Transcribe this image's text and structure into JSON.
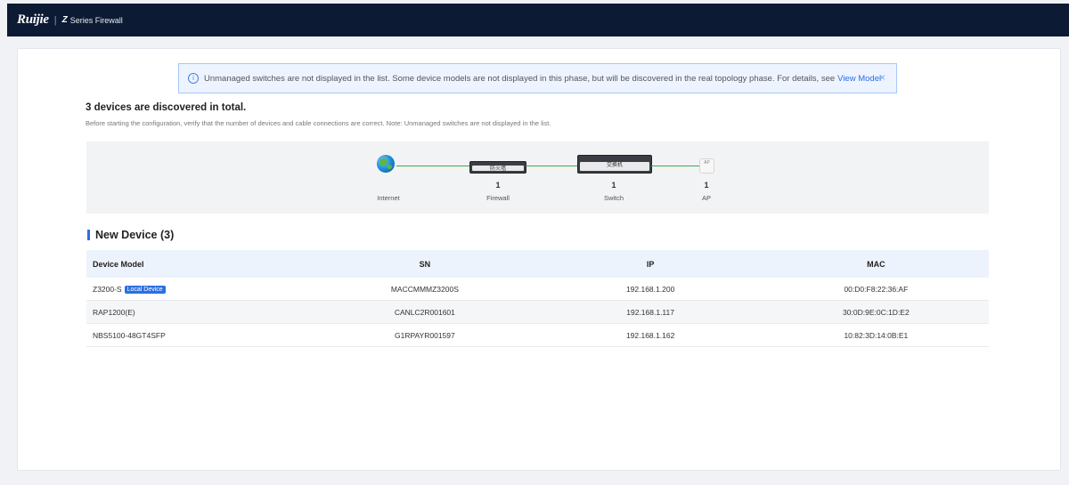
{
  "header": {
    "logo": "Ruijie",
    "separator": "|",
    "z_mark": "Z",
    "product": "Series Firewall"
  },
  "alert": {
    "text": "Unmanaged switches are not displayed in the list. Some device models are not displayed in this phase, but will be discovered in the real topology phase. For details, see",
    "link": "View Model",
    "close": "×",
    "info_glyph": "i"
  },
  "summary": {
    "title": "3 devices are discovered in total.",
    "description": "Before starting the configuration, verify that the number of devices and cable connections are correct. Note: Unmanaged switches are not displayed in the list."
  },
  "topology": {
    "nodes": [
      {
        "label": "Internet",
        "count": "",
        "icon": "globe-icon"
      },
      {
        "label": "Firewall",
        "count": "1",
        "icon": "firewall-icon",
        "face_text": "防火墙"
      },
      {
        "label": "Switch",
        "count": "1",
        "icon": "switch-icon",
        "face_text": "交换机"
      },
      {
        "label": "AP",
        "count": "1",
        "icon": "ap-icon",
        "face_text": "AP"
      }
    ],
    "link_color": "#3ea84a"
  },
  "section": {
    "title": "New Device  (3)"
  },
  "table": {
    "columns": [
      "Device Model",
      "SN",
      "IP",
      "MAC"
    ],
    "rows": [
      {
        "model": "Z3200-S",
        "badge": "Local Device",
        "sn": "MACCMMMZ3200S",
        "ip": "192.168.1.200",
        "mac": "00:D0:F8:22:36:AF"
      },
      {
        "model": "RAP1200(E)",
        "badge": "",
        "sn": "CANLC2R001601",
        "ip": "192.168.1.117",
        "mac": "30:0D:9E:0C:1D:E2"
      },
      {
        "model": "NBS5100-48GT4SFP",
        "badge": "",
        "sn": "G1RPAYR001597",
        "ip": "192.168.1.162",
        "mac": "10:82:3D:14:0B:E1"
      }
    ]
  },
  "colors": {
    "header_bg": "#0c1a33",
    "accent": "#2a6fe0",
    "alert_bg": "#edf4ff"
  }
}
